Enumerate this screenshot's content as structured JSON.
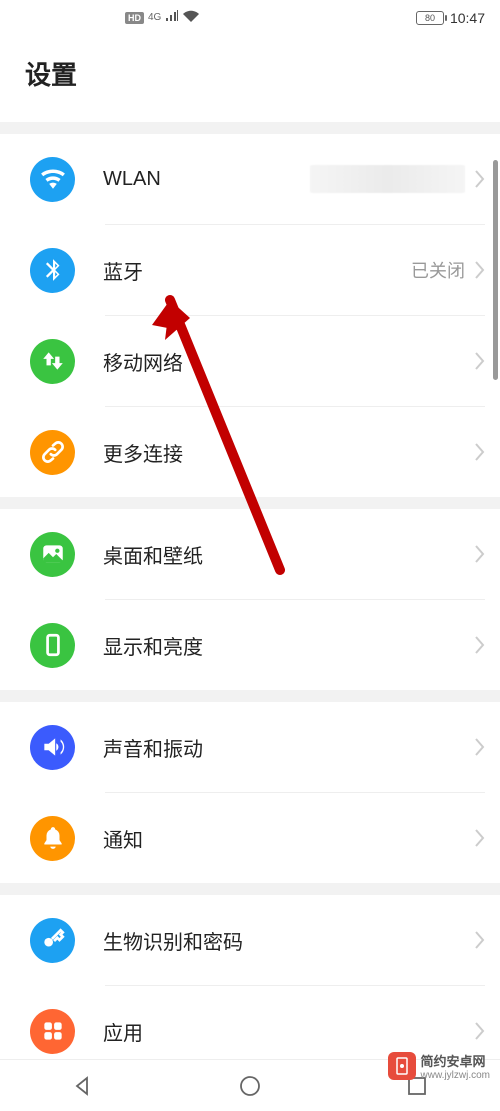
{
  "status_bar": {
    "hd": "HD",
    "network": "4G",
    "battery": "80",
    "time": "10:47"
  },
  "header": {
    "title": "设置"
  },
  "groups": [
    {
      "items": [
        {
          "key": "wlan",
          "label": "WLAN",
          "value": "",
          "icon": "wifi"
        },
        {
          "key": "bluetooth",
          "label": "蓝牙",
          "value": "已关闭",
          "icon": "bluetooth"
        },
        {
          "key": "mobile",
          "label": "移动网络",
          "value": "",
          "icon": "arrows-updown"
        },
        {
          "key": "more",
          "label": "更多连接",
          "value": "",
          "icon": "link"
        }
      ]
    },
    {
      "items": [
        {
          "key": "wallpaper",
          "label": "桌面和壁纸",
          "value": "",
          "icon": "image"
        },
        {
          "key": "display",
          "label": "显示和亮度",
          "value": "",
          "icon": "phone"
        }
      ]
    },
    {
      "items": [
        {
          "key": "sound",
          "label": "声音和振动",
          "value": "",
          "icon": "speaker"
        },
        {
          "key": "notifications",
          "label": "通知",
          "value": "",
          "icon": "bell"
        }
      ]
    },
    {
      "items": [
        {
          "key": "biometric",
          "label": "生物识别和密码",
          "value": "",
          "icon": "key"
        },
        {
          "key": "apps",
          "label": "应用",
          "value": "",
          "icon": "grid"
        }
      ]
    }
  ],
  "watermark": {
    "title": "简约安卓网",
    "url": "www.jylzwj.com"
  }
}
